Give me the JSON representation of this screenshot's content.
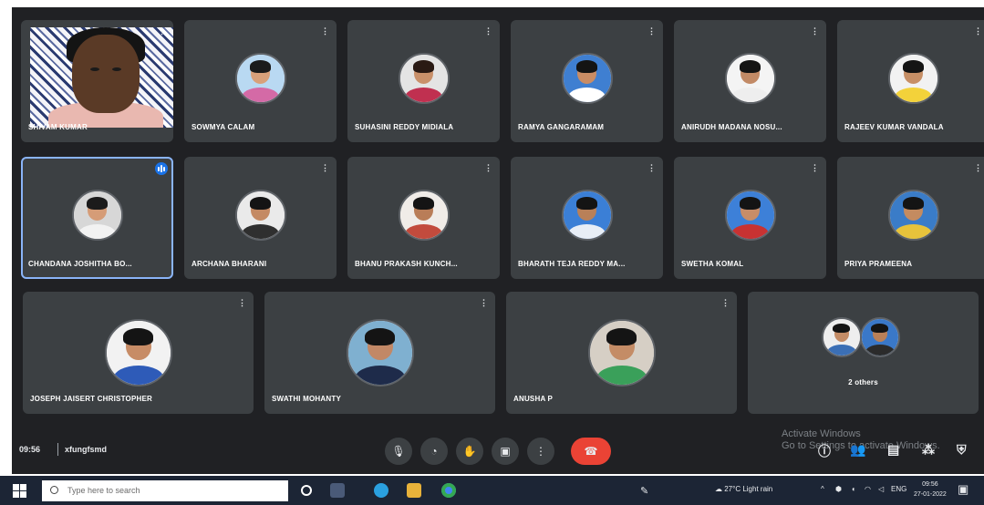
{
  "meeting": {
    "time": "09:56",
    "code": "xfungfsmd",
    "watermark_line1": "Activate Windows",
    "watermark_line2": "Go to Settings to activate Windows."
  },
  "participants": [
    {
      "name": "SHIVAM KUMAR",
      "type": "video",
      "more": "⋮"
    },
    {
      "name": "SOWMYA CALAM",
      "more": "⋮",
      "bg": "#b9d9f2",
      "skin": "#d8a07a",
      "hair": "#1b1b1b",
      "shirt": "#d46aa6"
    },
    {
      "name": "SUHASINI REDDY MIDIALA",
      "more": "⋮",
      "bg": "#e4e4e4",
      "skin": "#c9906a",
      "hair": "#2a1a14",
      "shirt": "#c03050"
    },
    {
      "name": "RAMYA GANGARAMAM",
      "more": "⋮",
      "bg": "#3f7fd1",
      "skin": "#c98c64",
      "hair": "#141414",
      "shirt": "#ffffff"
    },
    {
      "name": "ANIRUDH MADANA NOSU...",
      "more": "⋮",
      "bg": "#f4f4f4",
      "skin": "#c28a66",
      "hair": "#141414",
      "shirt": "#eeeeee"
    },
    {
      "name": "RAJEEV KUMAR VANDALA",
      "more": "⋮",
      "bg": "#f2f2f2",
      "skin": "#c78f66",
      "hair": "#141414",
      "shirt": "#f3d23a"
    },
    {
      "name": "CHANDANA JOSHITHA BO...",
      "more": "",
      "speaking": true,
      "bg": "#d7d7d7",
      "skin": "#d59c77",
      "hair": "#1b1b1b",
      "shirt": "#f2f2f2"
    },
    {
      "name": "ARCHANA BHARANI",
      "more": "⋮",
      "bg": "#eaeaea",
      "skin": "#c48a64",
      "hair": "#141414",
      "shirt": "#2f2f2f"
    },
    {
      "name": "BHANU PRAKASH KUNCH...",
      "more": "⋮",
      "bg": "#f0ece8",
      "skin": "#b97d58",
      "hair": "#141414",
      "shirt": "#c24b3d"
    },
    {
      "name": "BHARATH TEJA REDDY MA...",
      "more": "⋮",
      "bg": "#3b7fd6",
      "skin": "#b98058",
      "hair": "#141414",
      "shirt": "#e8eef6"
    },
    {
      "name": "SWETHA KOMAL",
      "more": "⋮",
      "bg": "#3d80d8",
      "skin": "#c88d68",
      "hair": "#141414",
      "shirt": "#c83232"
    },
    {
      "name": "PRIYA PRAMEENA",
      "more": "⋮",
      "bg": "#3a7cc8",
      "skin": "#c48b60",
      "hair": "#141414",
      "shirt": "#e7c33b"
    },
    {
      "name": "JOSEPH JAISERT CHRISTOPHER",
      "more": "⋮",
      "bg": "#f2f2f2",
      "skin": "#c78c66",
      "hair": "#141414",
      "shirt": "#2e5bb8"
    },
    {
      "name": "SWATHI MOHANTY",
      "more": "⋮",
      "bg": "#7fb0d0",
      "skin": "#c28866",
      "hair": "#141414",
      "shirt": "#1e2b4a"
    },
    {
      "name": "ANUSHA P",
      "more": "⋮",
      "bg": "#d6cfc5",
      "skin": "#c48c66",
      "hair": "#141414",
      "shirt": "#3aa05a"
    },
    {
      "name": "2 others",
      "more": "",
      "type": "duo",
      "a": {
        "bg": "#eeeeee",
        "skin": "#c48c66",
        "hair": "#141414",
        "shirt": "#3b6fb5"
      },
      "b": {
        "bg": "#3a78c8",
        "skin": "#b98058",
        "hair": "#141414",
        "shirt": "#2b2b2b"
      }
    }
  ],
  "controls": {
    "mic_icon": "microphone-icon",
    "caption_icon": "captions-icon",
    "hand_icon": "raise-hand-icon",
    "present_icon": "present-screen-icon",
    "more_icon": "more-options-icon",
    "end_icon": "end-call-icon",
    "right_icons": [
      "info-icon",
      "people-icon",
      "chat-icon",
      "activities-icon",
      "host-controls-icon"
    ]
  },
  "taskbar": {
    "search_placeholder": "Type here to search",
    "weather": "27°C Light rain",
    "clock_time": "09:56",
    "clock_date": "27-01-2022"
  },
  "colors": {
    "meet_bg": "#202124",
    "tile_bg": "#3c4043",
    "end_call": "#ea4335",
    "speaking": "#1a73e8",
    "taskbar": "#1c2535"
  }
}
